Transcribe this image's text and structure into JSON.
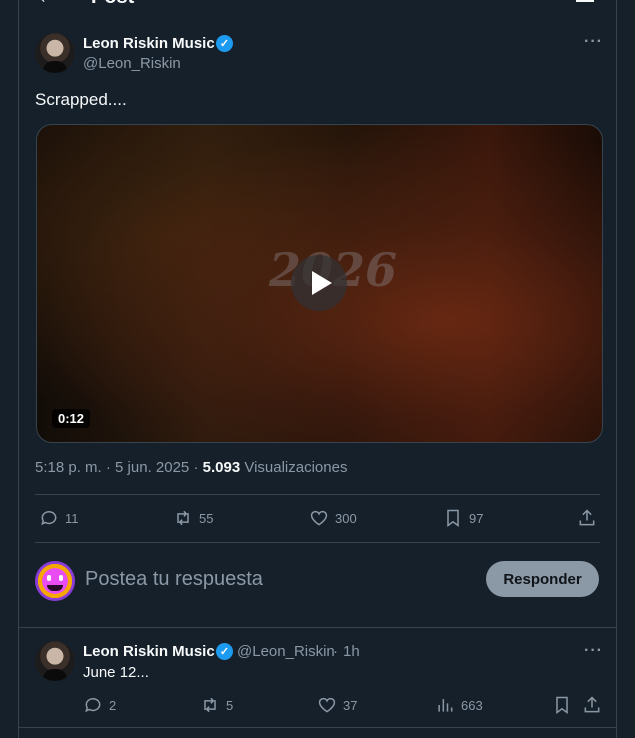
{
  "header": {
    "title": "Post"
  },
  "post": {
    "author_name": "Leon Riskin Music",
    "author_handle": "@Leon_Riskin",
    "text": "Scrapped....",
    "video_overlay_text": "2026",
    "video_duration": "0:12",
    "time": "5:18 p. m.",
    "date": "5 jun. 2025",
    "views_count": "5.093",
    "views_label": "Visualizaciones",
    "stats": {
      "replies": "11",
      "reposts": "55",
      "likes": "300",
      "bookmarks": "97"
    }
  },
  "composer": {
    "placeholder": "Postea tu respuesta",
    "button_label": "Responder"
  },
  "reply": {
    "author_name": "Leon Riskin Music",
    "author_handle": "@Leon_Riskin",
    "time": "1h",
    "text": "June 12...",
    "stats": {
      "replies": "2",
      "reposts": "5",
      "likes": "37",
      "views": "663"
    }
  },
  "colors": {
    "accent": "#1d9bf0",
    "background": "#15202b",
    "muted_text": "#8b98a5",
    "border": "#38444d"
  }
}
